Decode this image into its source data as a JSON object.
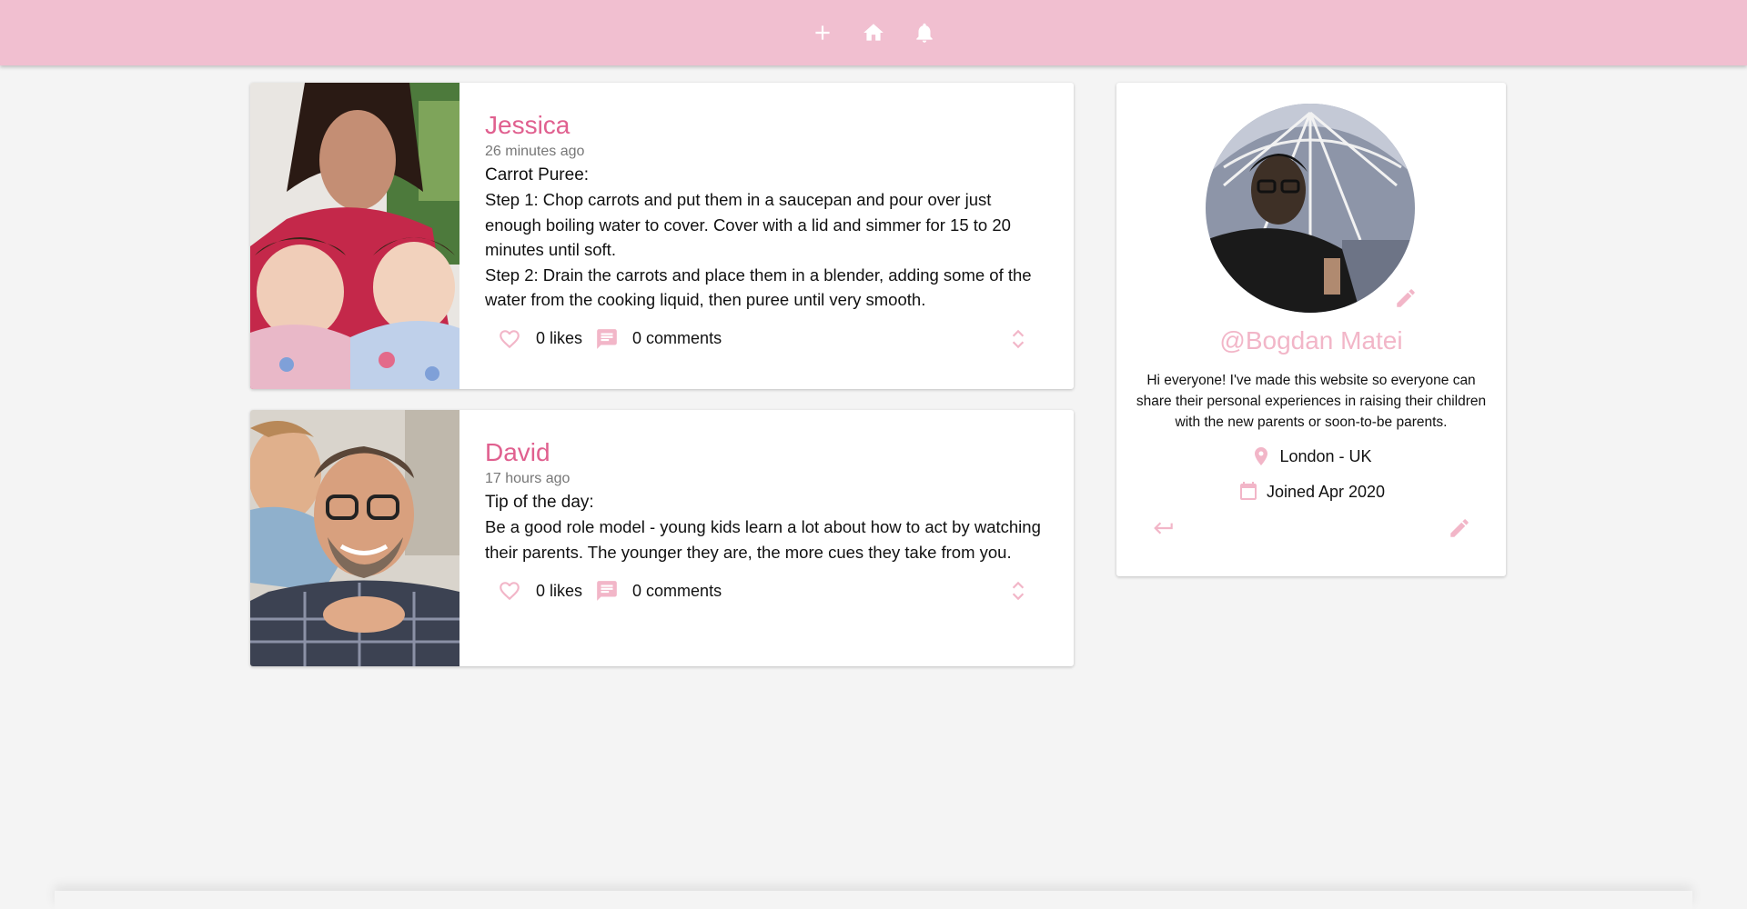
{
  "topbar": {
    "actions": [
      {
        "icon": "plus-icon"
      },
      {
        "icon": "home-icon"
      },
      {
        "icon": "bell-icon"
      }
    ],
    "background": "#f1bfd0"
  },
  "posts": [
    {
      "author": "Jessica",
      "time": "26 minutes ago",
      "title": "Carrot Puree:",
      "lines": [
        "Step 1: Chop carrots and put them in a saucepan and pour over just enough boiling water to cover. Cover with a lid and simmer for 15 to 20 minutes until soft.",
        "Step 2: Drain the carrots and place them in a blender, adding some of the water from the cooking liquid, then puree until very smooth."
      ],
      "likes": "0 likes",
      "comments": "0 comments"
    },
    {
      "author": "David",
      "time": "17 hours ago",
      "title": "Tip of the day:",
      "lines": [
        "Be a good role model - young kids learn a lot about how to act by watching their parents. The younger they are, the more cues they take from you."
      ],
      "likes": "0 likes",
      "comments": "0 comments"
    }
  ],
  "profile": {
    "username": "@Bogdan Matei",
    "bio": "Hi everyone! I've made this website so everyone can share their personal experiences in raising their children with the new parents or soon-to-be parents.",
    "location": "London - UK",
    "joined": "Joined Apr 2020"
  },
  "colors": {
    "accent": "#e0608f",
    "accent_light": "#f2b6c8"
  }
}
